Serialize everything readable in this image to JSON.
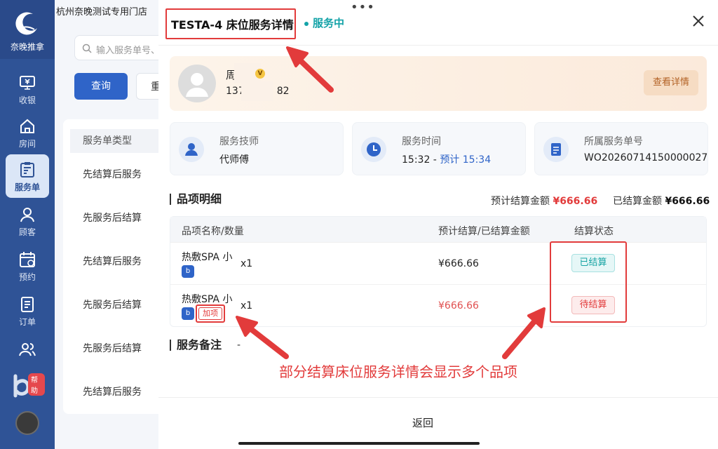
{
  "app": {
    "brand": "奈晚推拿",
    "store_name": "杭州奈晚测试专用门店"
  },
  "nav": {
    "items": [
      {
        "label": "收银",
        "icon": "cashier-icon"
      },
      {
        "label": "房间",
        "icon": "home-icon"
      },
      {
        "label": "服务单",
        "icon": "service-order-icon",
        "active": true
      },
      {
        "label": "顾客",
        "icon": "customer-icon"
      },
      {
        "label": "预约",
        "icon": "calendar-icon"
      },
      {
        "label": "订单",
        "icon": "order-icon"
      },
      {
        "label": "",
        "icon": "staff-icon"
      }
    ],
    "help_label": "帮助"
  },
  "background": {
    "search_placeholder": "输入服务单号、",
    "query_label": "查询",
    "reset_label": "重",
    "column_header": "服务单类型",
    "rows": [
      "先结算后服务",
      "先服务后结算",
      "先结算后服务",
      "先服务后结算",
      "先服务后结算",
      "先结算后服务"
    ]
  },
  "drawer": {
    "title": "TESTA-4 床位服务详情",
    "status": "服务中",
    "customer": {
      "name": "周",
      "phone": "137",
      "phone_tail": "82",
      "detail_label": "查看详情"
    },
    "info": {
      "therapist_label": "服务技师",
      "therapist_value": "代师傅",
      "time_label": "服务时间",
      "time_start": "15:32 -",
      "time_estimate": "预计 15:34",
      "order_label": "所属服务单号",
      "order_value": "WO20260714150000027"
    },
    "items_section": {
      "title": "品项明细",
      "est_label": "预计结算金额",
      "est_value": "¥666.66",
      "settled_label": "已结算金额",
      "settled_value": "¥666.66",
      "columns": [
        "品项名称/数量",
        "预计结算/已结算金额",
        "结算状态"
      ],
      "rows": [
        {
          "name": "热敷SPA 小",
          "qty": "x1",
          "amount": "¥666.66",
          "status": "已结算",
          "addon": ""
        },
        {
          "name": "热敷SPA 小",
          "qty": "x1",
          "amount": "¥666.66",
          "status": "待结算",
          "addon": "加项"
        }
      ]
    },
    "notes": {
      "title": "服务备注",
      "value": "-"
    },
    "annotation": "部分结算床位服务详情会显示多个品项",
    "back_label": "返回"
  },
  "colors": {
    "accent": "#2f64c8",
    "rail": "#2f5396",
    "annotation_red": "#e23b3b",
    "status_teal": "#14a3a8"
  }
}
